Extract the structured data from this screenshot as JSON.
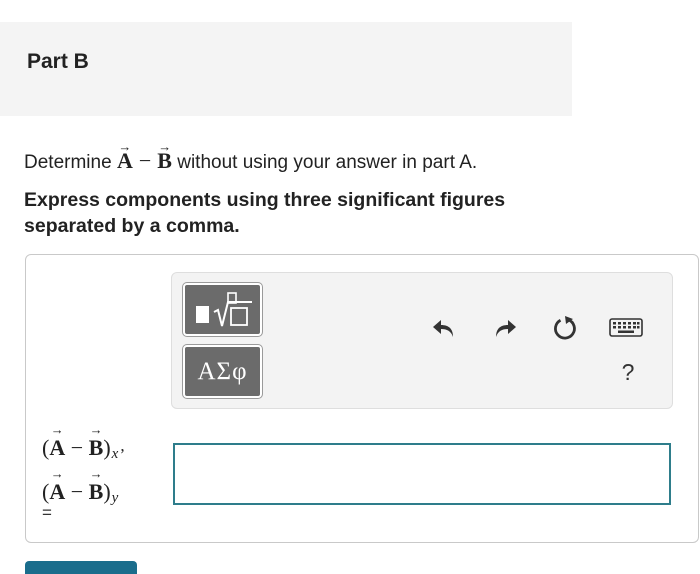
{
  "part": {
    "title": "Part B"
  },
  "question": {
    "prefix": "Determine",
    "vector_a": "A",
    "minus": "−",
    "vector_b": "B",
    "suffix": "without using your answer in part A."
  },
  "instructions": "Express components using three significant figures separated by a comma.",
  "toolbar": {
    "templates_icon": "templates-icon",
    "symbols_label": "ΑΣφ",
    "undo_icon": "undo-icon",
    "redo_icon": "redo-icon",
    "reset_icon": "reset-icon",
    "keyboard_icon": "keyboard-icon",
    "help_label": "?"
  },
  "answer": {
    "label_line1_open": "(",
    "label_a": "A",
    "label_minus": " − ",
    "label_b": "B",
    "label_line1_close": ")",
    "label_line1_sub": "x",
    "label_comma": ",",
    "label_line2_sub": "y",
    "equals": "=",
    "value": ""
  },
  "colors": {
    "header_bg": "#f4f4f4",
    "tool_button_bg": "#6b6b6b",
    "input_border": "#2e7d8b",
    "submit_bg": "#1a6d8c"
  }
}
